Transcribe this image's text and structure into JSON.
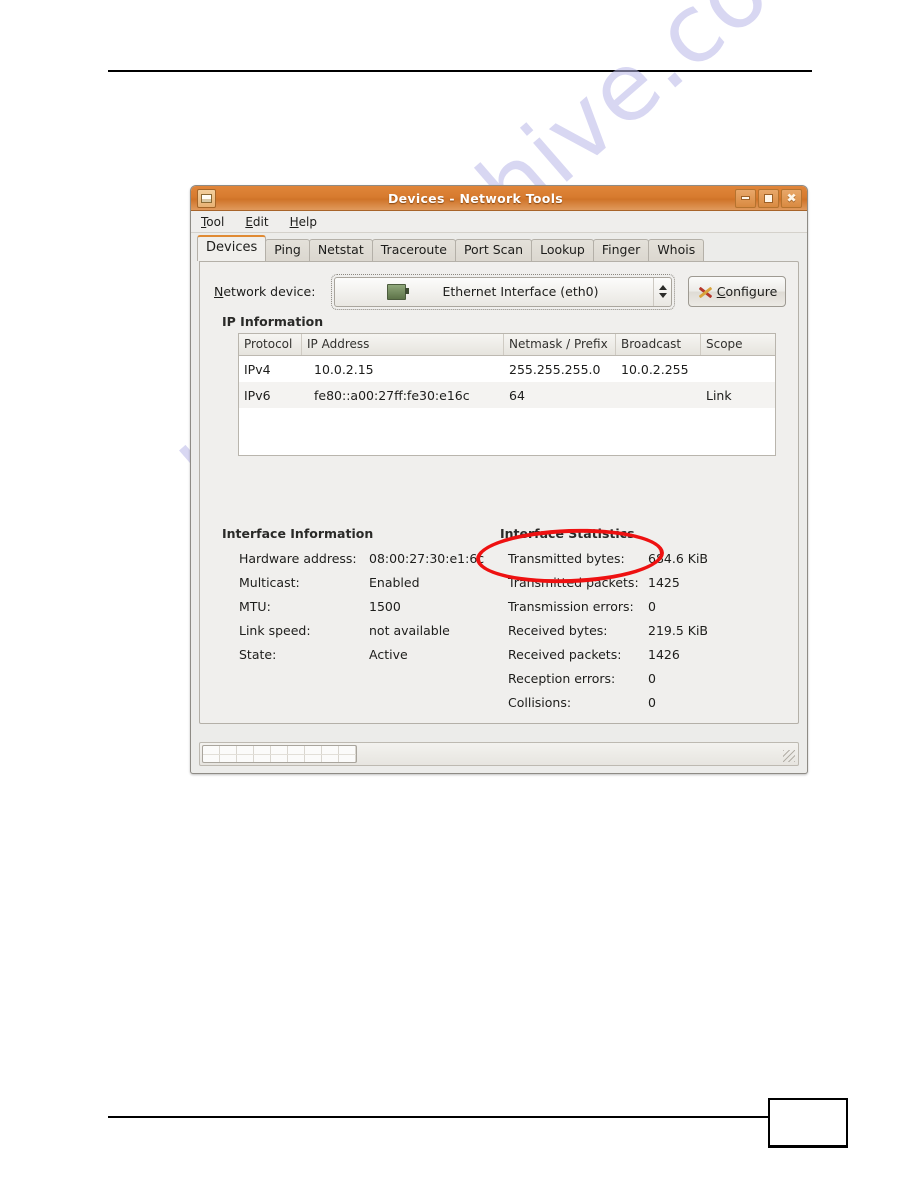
{
  "watermark": {
    "text": "manualshive.com"
  },
  "window": {
    "title": "Devices - Network Tools",
    "app_icon": "monitor-icon",
    "controls": {
      "minimize": "minimize-icon",
      "maximize": "maximize-icon",
      "close": "close-icon"
    }
  },
  "menubar": {
    "items": [
      {
        "label": "Tool",
        "mnemonic": "T"
      },
      {
        "label": "Edit",
        "mnemonic": "E"
      },
      {
        "label": "Help",
        "mnemonic": "H"
      }
    ]
  },
  "tabs": [
    {
      "label": "Devices",
      "active": true
    },
    {
      "label": "Ping",
      "active": false
    },
    {
      "label": "Netstat",
      "active": false
    },
    {
      "label": "Traceroute",
      "active": false
    },
    {
      "label": "Port Scan",
      "active": false
    },
    {
      "label": "Lookup",
      "active": false
    },
    {
      "label": "Finger",
      "active": false
    },
    {
      "label": "Whois",
      "active": false
    }
  ],
  "device_row": {
    "label": "Network device:",
    "label_mnemonic": "N",
    "selected_device": "Ethernet Interface (eth0)",
    "device_icon": "ethernet-card-icon",
    "configure_button": "Configure",
    "configure_mnemonic": "C",
    "configure_icon": "tools-icon"
  },
  "ip_information": {
    "title": "IP Information",
    "columns": [
      "Protocol",
      "IP Address",
      "Netmask / Prefix",
      "Broadcast",
      "Scope"
    ],
    "rows": [
      {
        "protocol": "IPv4",
        "address": "10.0.2.15",
        "netmask": "255.255.255.0",
        "broadcast": "10.0.2.255",
        "scope": ""
      },
      {
        "protocol": "IPv6",
        "address": "fe80::a00:27ff:fe30:e16c",
        "netmask": "64",
        "broadcast": "",
        "scope": "Link"
      }
    ]
  },
  "interface_information": {
    "title": "Interface Information",
    "rows": [
      {
        "key": "Hardware address:",
        "value": "08:00:27:30:e1:6c"
      },
      {
        "key": "Multicast:",
        "value": "Enabled"
      },
      {
        "key": "MTU:",
        "value": "1500"
      },
      {
        "key": "Link speed:",
        "value": "not available"
      },
      {
        "key": "State:",
        "value": "Active"
      }
    ]
  },
  "interface_statistics": {
    "title": "Interface Statistics",
    "rows": [
      {
        "key": "Transmitted bytes:",
        "value": "684.6 KiB"
      },
      {
        "key": "Transmitted packets:",
        "value": "1425"
      },
      {
        "key": "Transmission errors:",
        "value": "0"
      },
      {
        "key": "Received bytes:",
        "value": "219.5 KiB"
      },
      {
        "key": "Received packets:",
        "value": "1426"
      },
      {
        "key": "Reception errors:",
        "value": "0"
      },
      {
        "key": "Collisions:",
        "value": "0"
      }
    ]
  },
  "annotation": {
    "shape": "ellipse",
    "color": "#ee1111",
    "target": "Interface Statistics"
  },
  "statusbar": {
    "progress_widget": "segmented-progress"
  },
  "page": {
    "number": ""
  },
  "colors": {
    "titlebar_accent": "#d77b2f",
    "active_tab_indicator": "#e08a33",
    "annotation_red": "#ee1111",
    "watermark": "#b9b7e8",
    "window_bg": "#ececea"
  }
}
